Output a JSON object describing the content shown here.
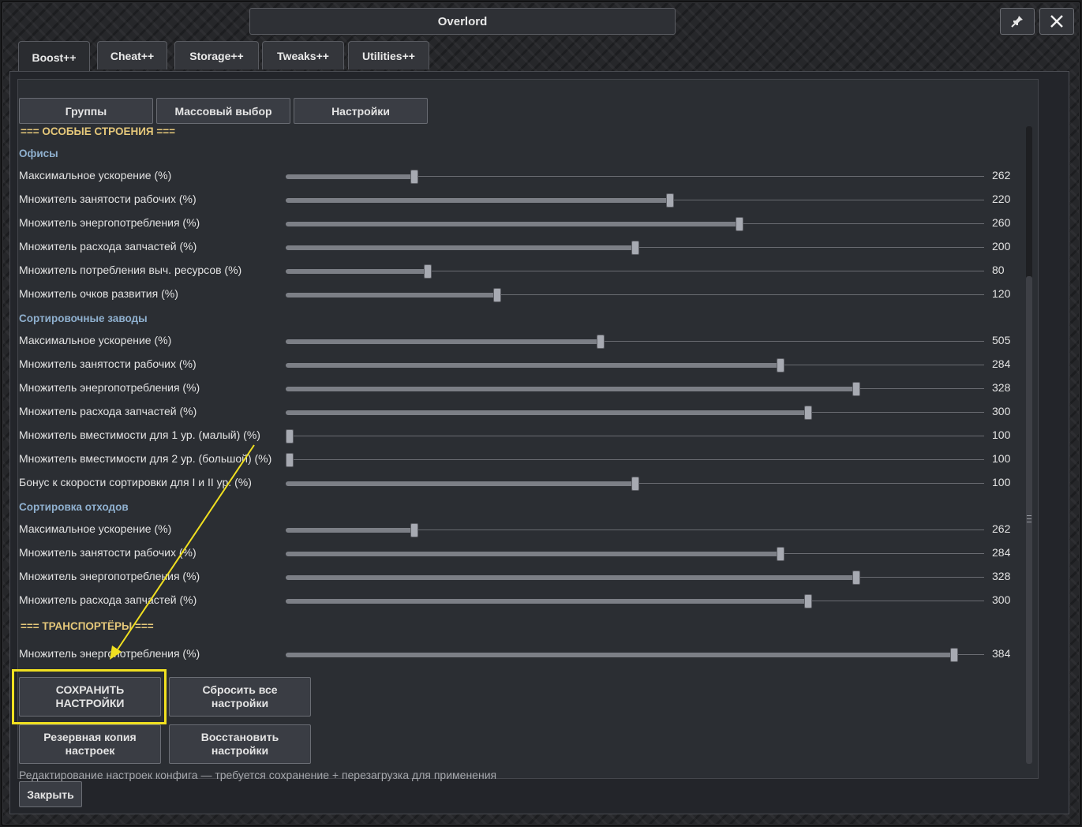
{
  "window": {
    "title": "Overlord",
    "pin_icon": "pin-icon",
    "close_icon": "close-icon"
  },
  "tabs": [
    {
      "label": "Boost++",
      "active": true
    },
    {
      "label": "Cheat++",
      "active": false
    },
    {
      "label": "Storage++",
      "active": false
    },
    {
      "label": "Tweaks++",
      "active": false
    },
    {
      "label": "Utilities++",
      "active": false
    }
  ],
  "subtabs": [
    "Группы",
    "Массовый выбор",
    "Настройки"
  ],
  "sections": {
    "special_buildings": "=== ОСОБЫЕ СТРОЕНИЯ ===",
    "transporters": "=== ТРАНСПОРТЁРЫ ==="
  },
  "groups": {
    "offices": "Офисы",
    "sorting_plants": "Сортировочные заводы",
    "waste_sorting": "Сортировка отходов"
  },
  "offices_rows": [
    {
      "label": "Максимальное ускорение (%)",
      "value": "262",
      "fraction": 0.18
    },
    {
      "label": "Множитель занятости рабочих (%)",
      "value": "220",
      "fraction": 0.551
    },
    {
      "label": "Множитель энергопотребления (%)",
      "value": "260",
      "fraction": 0.651
    },
    {
      "label": "Множитель расхода запчастей (%)",
      "value": "200",
      "fraction": 0.501
    },
    {
      "label": "Множитель потребления выч. ресурсов (%)",
      "value": "80",
      "fraction": 0.2
    },
    {
      "label": "Множитель очков развития (%)",
      "value": "120",
      "fraction": 0.3
    }
  ],
  "sorting_rows": [
    {
      "label": "Максимальное ускорение (%)",
      "value": "505",
      "fraction": 0.45
    },
    {
      "label": "Множитель занятости рабочих (%)",
      "value": "284",
      "fraction": 0.711
    },
    {
      "label": "Множитель энергопотребления (%)",
      "value": "328",
      "fraction": 0.821
    },
    {
      "label": "Множитель расхода запчастей (%)",
      "value": "300",
      "fraction": 0.751
    },
    {
      "label": "Множитель вместимости для 1 ур. (малый) (%)",
      "value": "100",
      "fraction": 0.0
    },
    {
      "label": "Множитель вместимости для 2 ур. (большой) (%)",
      "value": "100",
      "fraction": 0.0
    },
    {
      "label": "Бонус к скорости сортировки для I и II ур. (%)",
      "value": "100",
      "fraction": 0.501
    }
  ],
  "waste_rows": [
    {
      "label": "Максимальное ускорение (%)",
      "value": "262",
      "fraction": 0.18
    },
    {
      "label": "Множитель занятости рабочих (%)",
      "value": "284",
      "fraction": 0.711
    },
    {
      "label": "Множитель энергопотребления (%)",
      "value": "328",
      "fraction": 0.821
    },
    {
      "label": "Множитель расхода запчастей (%)",
      "value": "300",
      "fraction": 0.751
    }
  ],
  "transporter_rows": [
    {
      "label": "Множитель энергопотребления (%)",
      "value": "384",
      "fraction": 0.962
    }
  ],
  "actions": {
    "save": "СОХРАНИТЬ НАСТРОЙКИ",
    "reset": "Сбросить все настройки",
    "backup": "Резервная копия настроек",
    "restore": "Восстановить настройки"
  },
  "status_text": "Редактирование настроек конфига — требуется сохранение + перезагрузка для применения",
  "close_label": "Закрыть",
  "colors": {
    "section_heading": "#e6c87a",
    "group_heading": "#8fb0cf",
    "highlight": "#f0e020",
    "arrow": "#f0e020"
  }
}
